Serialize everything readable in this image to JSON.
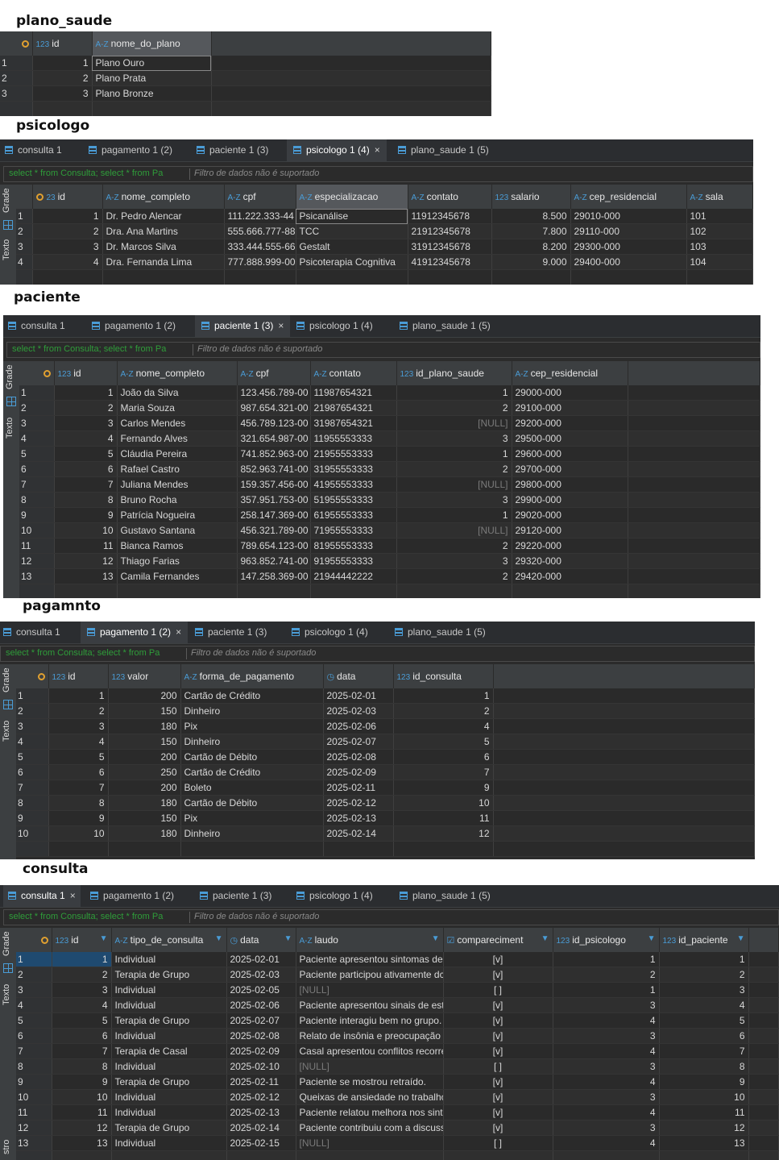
{
  "sections": {
    "plano_saude": "plano_saude",
    "psicologo": "psicologo",
    "paciente": "paciente",
    "pagamento": "pagamnto",
    "consulta": "consulta"
  },
  "tabs": {
    "consulta": "consulta 1",
    "pagamento": "pagamento 1 (2)",
    "paciente": "paciente 1 (3)",
    "psicologo": "psicologo 1 (4)",
    "plano_saude": "plano_saude 1 (5)",
    "close": "×"
  },
  "query": {
    "text": "select * from Consulta; select * from Pa",
    "filter": "Filtro de dados não é suportado"
  },
  "side": {
    "grade": "Grade",
    "texto": "Texto",
    "registro": "stro"
  },
  "tables": {
    "plano_saude": {
      "columns": [
        "id",
        "nome_do_plano"
      ],
      "rows": [
        [
          "1",
          "Plano Ouro"
        ],
        [
          "2",
          "Plano Prata"
        ],
        [
          "3",
          "Plano Bronze"
        ]
      ]
    },
    "psicologo": {
      "columns": [
        "id",
        "nome_completo",
        "cpf",
        "especializacao",
        "contato",
        "salario",
        "cep_residencial",
        "sala"
      ],
      "rows": [
        [
          "1",
          "Dr. Pedro Alencar",
          "111.222.333-44",
          "Psicanálise",
          "11912345678",
          "8.500",
          "29010-000",
          "101"
        ],
        [
          "2",
          "Dra. Ana Martins",
          "555.666.777-88",
          "TCC",
          "21912345678",
          "7.800",
          "29110-000",
          "102"
        ],
        [
          "3",
          "Dr. Marcos Silva",
          "333.444.555-66",
          "Gestalt",
          "31912345678",
          "8.200",
          "29300-000",
          "103"
        ],
        [
          "4",
          "Dra. Fernanda Lima",
          "777.888.999-00",
          "Psicoterapia Cognitiva",
          "41912345678",
          "9.000",
          "29400-000",
          "104"
        ]
      ]
    },
    "paciente": {
      "columns": [
        "id",
        "nome_completo",
        "cpf",
        "contato",
        "id_plano_saude",
        "cep_residencial"
      ],
      "rows": [
        [
          "1",
          "João da Silva",
          "123.456.789-00",
          "11987654321",
          "1",
          "29000-000"
        ],
        [
          "2",
          "Maria Souza",
          "987.654.321-00",
          "21987654321",
          "2",
          "29100-000"
        ],
        [
          "3",
          "Carlos Mendes",
          "456.789.123-00",
          "31987654321",
          "[NULL]",
          "29200-000"
        ],
        [
          "4",
          "Fernando Alves",
          "321.654.987-00",
          "11955553333",
          "3",
          "29500-000"
        ],
        [
          "5",
          "Cláudia Pereira",
          "741.852.963-00",
          "21955553333",
          "1",
          "29600-000"
        ],
        [
          "6",
          "Rafael Castro",
          "852.963.741-00",
          "31955553333",
          "2",
          "29700-000"
        ],
        [
          "7",
          "Juliana Mendes",
          "159.357.456-00",
          "41955553333",
          "[NULL]",
          "29800-000"
        ],
        [
          "8",
          "Bruno Rocha",
          "357.951.753-00",
          "51955553333",
          "3",
          "29900-000"
        ],
        [
          "9",
          "Patrícia Nogueira",
          "258.147.369-00",
          "61955553333",
          "1",
          "29020-000"
        ],
        [
          "10",
          "Gustavo Santana",
          "456.321.789-00",
          "71955553333",
          "[NULL]",
          "29120-000"
        ],
        [
          "11",
          "Bianca Ramos",
          "789.654.123-00",
          "81955553333",
          "2",
          "29220-000"
        ],
        [
          "12",
          "Thiago Farias",
          "963.852.741-00",
          "91955553333",
          "3",
          "29320-000"
        ],
        [
          "13",
          "Camila Fernandes",
          "147.258.369-00",
          "21944442222",
          "2",
          "29420-000"
        ]
      ]
    },
    "pagamento": {
      "columns": [
        "id",
        "valor",
        "forma_de_pagamento",
        "data",
        "id_consulta"
      ],
      "rows": [
        [
          "1",
          "200",
          "Cartão de Crédito",
          "2025-02-01",
          "1"
        ],
        [
          "2",
          "150",
          "Dinheiro",
          "2025-02-03",
          "2"
        ],
        [
          "3",
          "180",
          "Pix",
          "2025-02-06",
          "4"
        ],
        [
          "4",
          "150",
          "Dinheiro",
          "2025-02-07",
          "5"
        ],
        [
          "5",
          "200",
          "Cartão de Débito",
          "2025-02-08",
          "6"
        ],
        [
          "6",
          "250",
          "Cartão de Crédito",
          "2025-02-09",
          "7"
        ],
        [
          "7",
          "200",
          "Boleto",
          "2025-02-11",
          "9"
        ],
        [
          "8",
          "180",
          "Cartão de Débito",
          "2025-02-12",
          "10"
        ],
        [
          "9",
          "150",
          "Pix",
          "2025-02-13",
          "11"
        ],
        [
          "10",
          "180",
          "Dinheiro",
          "2025-02-14",
          "12"
        ]
      ]
    },
    "consulta": {
      "columns": [
        "id",
        "tipo_de_consulta",
        "data",
        "laudo",
        "compareciment",
        "id_psicologo",
        "id_paciente"
      ],
      "rows": [
        [
          "1",
          "Individual",
          "2025-02-01",
          "Paciente apresentou sintomas de",
          "[v]",
          "1",
          "1"
        ],
        [
          "2",
          "Terapia de Grupo",
          "2025-02-03",
          "Paciente participou ativamente dc",
          "[v]",
          "2",
          "2"
        ],
        [
          "3",
          "Individual",
          "2025-02-05",
          "[NULL]",
          "[ ]",
          "1",
          "3"
        ],
        [
          "4",
          "Individual",
          "2025-02-06",
          "Paciente apresentou sinais de estr",
          "[v]",
          "3",
          "4"
        ],
        [
          "5",
          "Terapia de Grupo",
          "2025-02-07",
          "Paciente interagiu bem no grupo.",
          "[v]",
          "4",
          "5"
        ],
        [
          "6",
          "Individual",
          "2025-02-08",
          "Relato de insônia e preocupação e",
          "[v]",
          "3",
          "6"
        ],
        [
          "7",
          "Terapia de Casal",
          "2025-02-09",
          "Casal apresentou conflitos recorre",
          "[v]",
          "4",
          "7"
        ],
        [
          "8",
          "Individual",
          "2025-02-10",
          "[NULL]",
          "[ ]",
          "3",
          "8"
        ],
        [
          "9",
          "Terapia de Grupo",
          "2025-02-11",
          "Paciente se mostrou retraído.",
          "[v]",
          "4",
          "9"
        ],
        [
          "10",
          "Individual",
          "2025-02-12",
          "Queixas de ansiedade no trabalho",
          "[v]",
          "3",
          "10"
        ],
        [
          "11",
          "Individual",
          "2025-02-13",
          "Paciente relatou melhora nos sint",
          "[v]",
          "4",
          "11"
        ],
        [
          "12",
          "Terapia de Grupo",
          "2025-02-14",
          "Paciente contribuiu com a discuss",
          "[v]",
          "3",
          "12"
        ],
        [
          "13",
          "Individual",
          "2025-02-15",
          "[NULL]",
          "[ ]",
          "4",
          "13"
        ]
      ]
    }
  }
}
